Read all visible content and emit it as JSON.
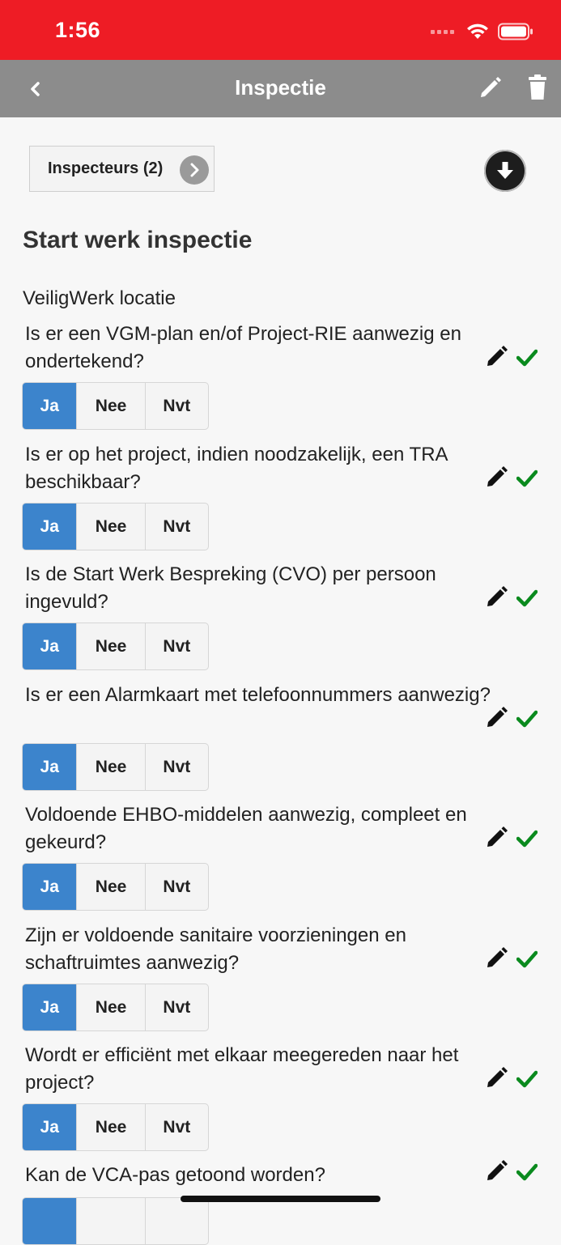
{
  "status": {
    "time": "1:56"
  },
  "nav": {
    "title": "Inspectie"
  },
  "inspectors_label": "Inspecteurs (2)",
  "section_title": "Start werk inspectie",
  "section_sub": "VeiligWerk locatie",
  "options": {
    "ja": "Ja",
    "nee": "Nee",
    "nvt": "Nvt"
  },
  "selected_option": "Ja",
  "colors": {
    "status_bar": "#ee1c25",
    "nav_bar": "#8c8c8c",
    "selected": "#3c84cc",
    "check": "#0a8a1e"
  },
  "icons": [
    "back-chevron-icon",
    "pencil-icon",
    "trash-icon",
    "chevron-right-icon",
    "download-icon",
    "check-icon"
  ],
  "questions": [
    {
      "text": "Is er een VGM-plan en/of Project-RIE aanwezig en ondertekend?"
    },
    {
      "text": "Is er op het project, indien noodzakelijk, een TRA beschikbaar?"
    },
    {
      "text": "Is de Start Werk Bespreking (CVO) per persoon ingevuld?"
    },
    {
      "text": "Is er een Alarmkaart met telefoonnummers aanwezig?"
    },
    {
      "text": "Voldoende EHBO-middelen aanwezig, compleet en gekeurd?"
    },
    {
      "text": "Zijn er voldoende sanitaire voorzieningen en schaftruimtes aanwezig?"
    },
    {
      "text": "Wordt er efficiënt met elkaar meegereden naar het project?"
    },
    {
      "text": "Kan de VCA-pas getoond worden?"
    }
  ]
}
